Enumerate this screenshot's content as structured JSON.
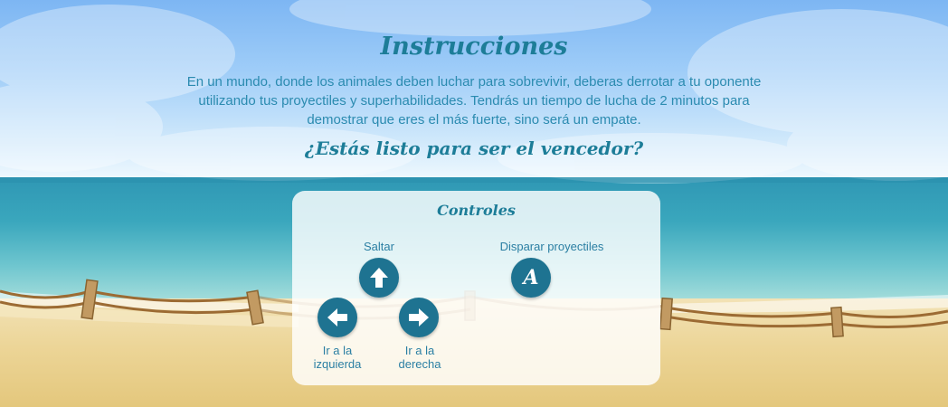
{
  "instructions": {
    "title": "Instrucciones",
    "description": "En un mundo, donde los animales deben luchar para sobrevivir, deberas derrotar a tu oponente utilizando tus proyectiles y superhabilidades. Tendrás un tiempo de lucha de 2 minutos para demostrar que eres el más fuerte, sino será un empate.",
    "question": "¿Estás listo para ser el vencedor?"
  },
  "controls": {
    "title": "Controles",
    "jump": {
      "label": "Saltar",
      "key_icon": "arrow-up-icon"
    },
    "shoot": {
      "label": "Disparar proyectiles",
      "key": "A"
    },
    "left": {
      "label_line1": "Ir a la",
      "label_line2": "izquierda",
      "key_icon": "arrow-left-icon"
    },
    "right": {
      "label_line1": "Ir a la",
      "label_line2": "derecha",
      "key_icon": "arrow-right-icon"
    }
  },
  "colors": {
    "title": "#1d7d98",
    "text": "#2b8bb0",
    "key_button": "#1e7391",
    "sea": "#3aa7bd",
    "sand": "#ecd597"
  }
}
